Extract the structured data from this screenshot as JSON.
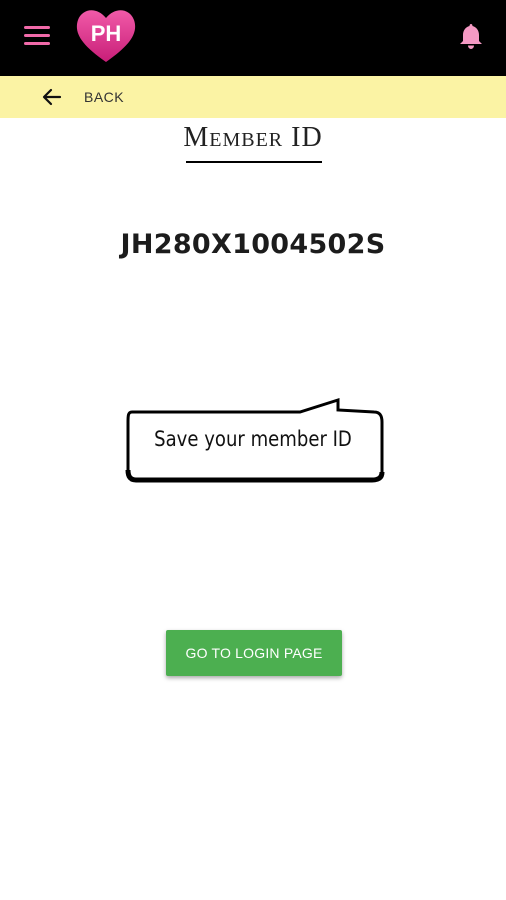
{
  "header": {
    "menu_icon": "hamburger-menu-icon",
    "logo": "heart-logo",
    "logo_text": "PH",
    "notification_icon": "bell-icon",
    "brand_pink": "#e8378c",
    "accent_pink": "#f06aa9"
  },
  "backbar": {
    "icon": "arrow-left-icon",
    "label": "BACK",
    "background": "#fbf3a4"
  },
  "page": {
    "title": "Member ID",
    "member_id": "JH280X1004502S",
    "tip": "Save your member ID"
  },
  "actions": {
    "login_label": "GO TO LOGIN PAGE",
    "login_color": "#4caf50"
  }
}
